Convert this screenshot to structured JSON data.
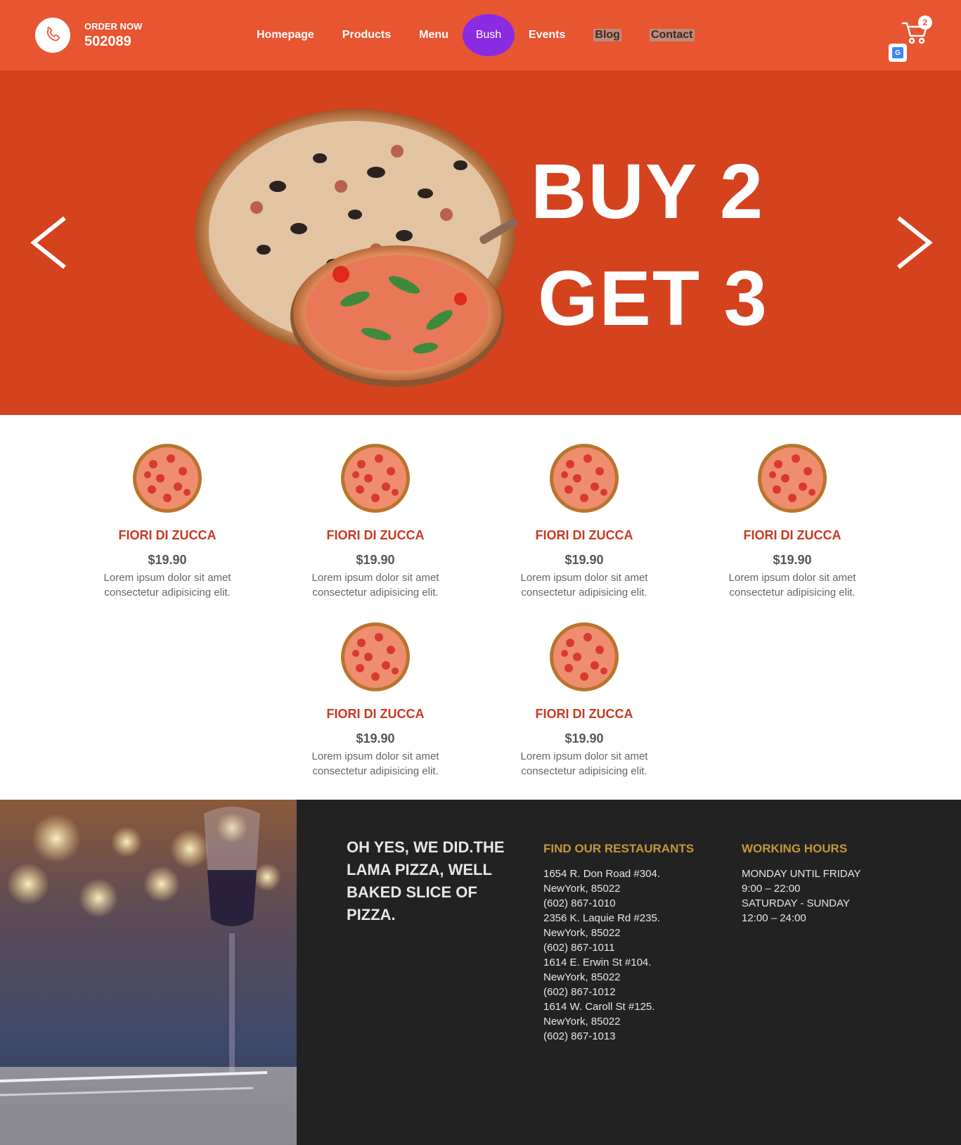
{
  "nav": {
    "order_label": "ORDER NOW",
    "order_number": "502089",
    "items": [
      "Homepage",
      "Products",
      "Menu",
      "Bush",
      "Events",
      "Blog",
      "Contact"
    ],
    "cart_count": "2"
  },
  "hero": {
    "line1": "BUY 2",
    "line2": "GET 3"
  },
  "products": [
    {
      "name": "FIORI DI ZUCCA",
      "price": "$19.90",
      "desc_line1": "Lorem ipsum dolor sit amet",
      "desc_line2": "consectetur adipisicing elit."
    },
    {
      "name": "FIORI DI ZUCCA",
      "price": "$19.90",
      "desc_line1": "Lorem ipsum dolor sit amet",
      "desc_line2": "consectetur adipisicing elit."
    },
    {
      "name": "FIORI DI ZUCCA",
      "price": "$19.90",
      "desc_line1": "Lorem ipsum dolor sit amet",
      "desc_line2": "consectetur adipisicing elit."
    },
    {
      "name": "FIORI DI ZUCCA",
      "price": "$19.90",
      "desc_line1": "Lorem ipsum dolor sit amet",
      "desc_line2": "consectetur adipisicing elit."
    },
    {
      "name": "FIORI DI ZUCCA",
      "price": "$19.90",
      "desc_line1": "Lorem ipsum dolor sit amet",
      "desc_line2": "consectetur adipisicing elit."
    },
    {
      "name": "FIORI DI ZUCCA",
      "price": "$19.90",
      "desc_line1": "Lorem ipsum dolor sit amet",
      "desc_line2": "consectetur adipisicing elit."
    }
  ],
  "footer": {
    "slogan": "OH YES, WE DID.THE LAMA PIZZA, WELL BAKED SLICE OF PIZZA.",
    "restaurants_title": "FIND OUR RESTAURANTS",
    "restaurants": [
      {
        "address": "1654 R. Don Road #304.",
        "city": "NewYork, 85022",
        "phone": "(602) 867-1010"
      },
      {
        "address": "2356 K. Laquie Rd #235.",
        "city": "NewYork, 85022",
        "phone": "(602) 867-1011"
      },
      {
        "address": "1614 E. Erwin St #104.",
        "city": "NewYork, 85022",
        "phone": "(602) 867-1012"
      },
      {
        "address": "1614 W. Caroll St #125.",
        "city": "NewYork, 85022",
        "phone": "(602) 867-1013"
      }
    ],
    "hours_title": "WORKING HOURS",
    "hours": [
      "MONDAY UNTIL FRIDAY",
      "9:00 – 22:00",
      "SATURDAY - SUNDAY",
      "12:00 – 24:00"
    ]
  },
  "colors": {
    "navbar": "#e85531",
    "hero": "#d4421e",
    "active_nav": "#8a2be2",
    "product_title": "#c83a22",
    "footer_bg": "#222222",
    "footer_heading": "#c8963a"
  }
}
